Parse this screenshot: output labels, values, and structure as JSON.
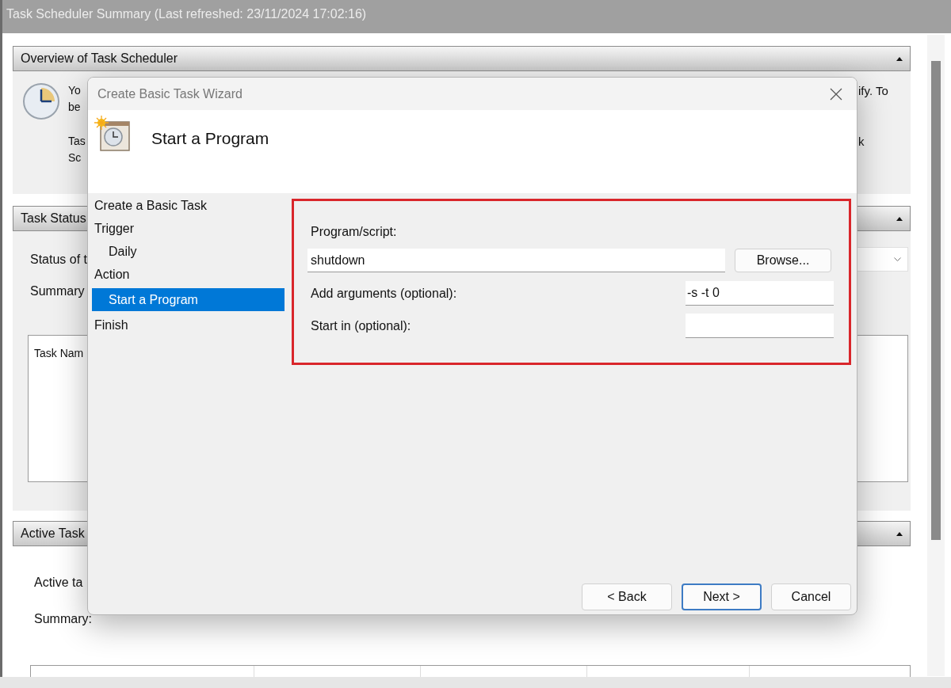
{
  "background_window": {
    "title": "Task Scheduler Summary (Last refreshed: 23/11/2024 17:02:16)",
    "overview": {
      "header": "Overview of Task Scheduler",
      "left_lines": [
        "Yo",
        "be",
        "Tas",
        "Sc"
      ],
      "right_lines": [
        "ify. To",
        "k"
      ]
    },
    "task_status": {
      "header": "Task Status",
      "labels": [
        "Status of t",
        "Summary"
      ],
      "list_header": "Task Nam"
    },
    "active_tasks": {
      "header": "Active Task",
      "labels": [
        "Active ta",
        "Summary:"
      ]
    }
  },
  "dialog": {
    "title": "Create Basic Task Wizard",
    "heading": "Start a Program",
    "steps": [
      {
        "label": "Create a Basic Task",
        "selected": false
      },
      {
        "label": "Trigger",
        "selected": false,
        "children": [
          {
            "label": "Daily",
            "selected": false
          }
        ]
      },
      {
        "label": "Action",
        "selected": false,
        "children": [
          {
            "label": "Start a Program",
            "selected": true
          }
        ]
      },
      {
        "label": "Finish",
        "selected": false
      }
    ],
    "fields": [
      {
        "kind": "stacked",
        "label": "Program/script:",
        "value": "shutdown",
        "button": "Browse..."
      },
      {
        "kind": "inline",
        "label": "Add arguments (optional):",
        "value": "-s -t 0"
      },
      {
        "kind": "inline",
        "label": "Start in (optional):"
      }
    ],
    "buttons": [
      {
        "label": "< Back",
        "default": false
      },
      {
        "label": "Next >",
        "default": true
      },
      {
        "label": "Cancel",
        "default": false
      }
    ]
  }
}
